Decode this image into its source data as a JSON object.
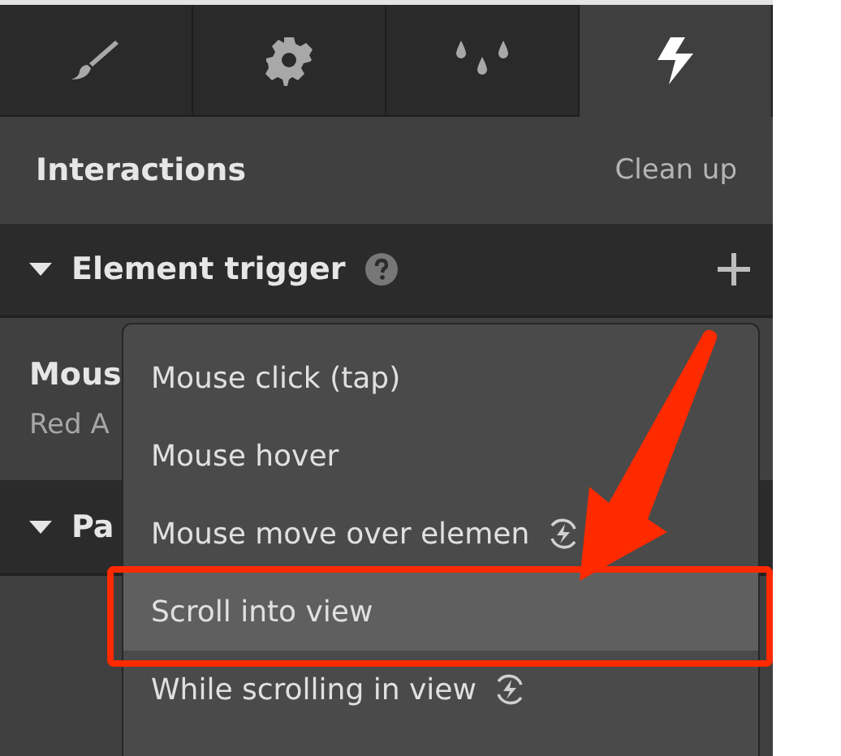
{
  "tabs": [
    {
      "selected": false
    },
    {
      "selected": false
    },
    {
      "selected": false
    },
    {
      "selected": true
    }
  ],
  "header": {
    "title": "Interactions",
    "action": "Clean up"
  },
  "section": {
    "title": "Element trigger",
    "expanded": true
  },
  "trigger": {
    "name": "Mous",
    "target": "Red A"
  },
  "section_2": {
    "title": "Pa",
    "expanded": true
  },
  "menu": [
    {
      "label": "Mouse click (tap)",
      "selected": false,
      "icon": false
    },
    {
      "label": "Mouse hover",
      "selected": false,
      "icon": false
    },
    {
      "label": "Mouse move over elemen",
      "selected": false,
      "icon": true
    },
    {
      "label": "Scroll into view",
      "selected": true,
      "icon": false
    },
    {
      "label": "While scrolling in view",
      "selected": false,
      "icon": true
    }
  ]
}
